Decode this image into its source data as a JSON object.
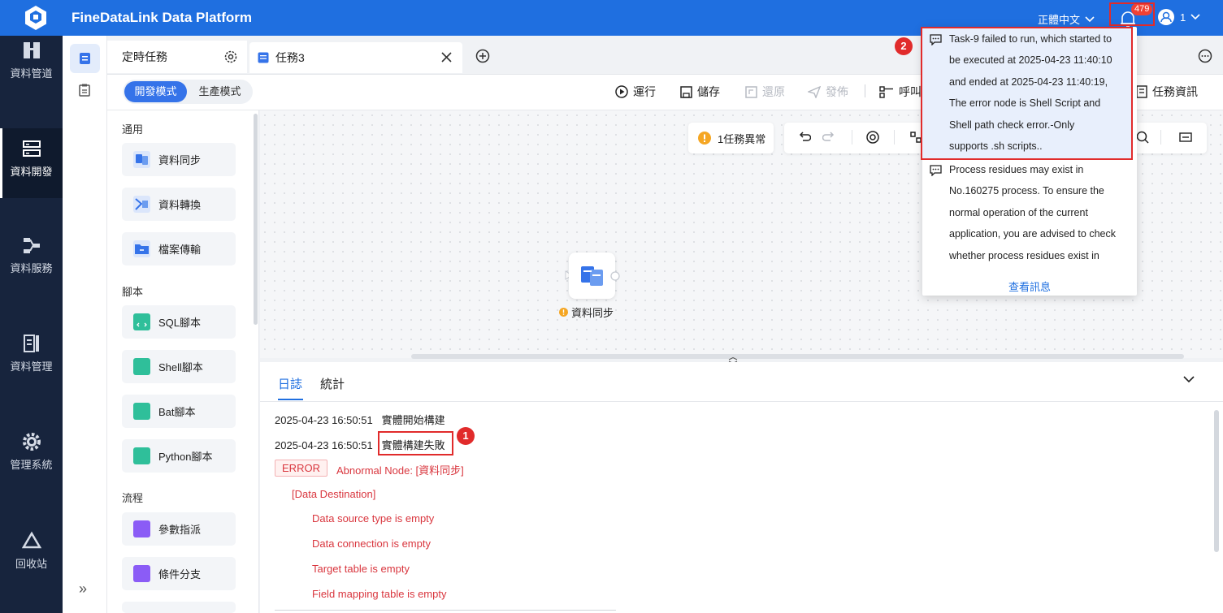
{
  "app": {
    "title": "FineDataLink Data Platform",
    "language": "正體中文",
    "notification_count": "479",
    "user": "1"
  },
  "nav": {
    "items": [
      {
        "label": "資料管道",
        "icon": "pipeline-icon"
      },
      {
        "label": "資料開發",
        "icon": "data-dev-icon",
        "active": true
      },
      {
        "label": "資料服務",
        "icon": "data-service-icon"
      },
      {
        "label": "資料管理",
        "icon": "data-management-icon"
      },
      {
        "label": "管理系統",
        "icon": "gear-icon"
      },
      {
        "label": "回收站",
        "icon": "recycle-icon"
      }
    ],
    "expand": "»"
  },
  "tabs": {
    "scheduled": "定時任務",
    "task": "任務3"
  },
  "mode": {
    "dev": "開發模式",
    "prod": "生產模式"
  },
  "toolbar": {
    "run": "運行",
    "save": "儲存",
    "restore": "還原",
    "publish": "發佈",
    "call": "呼叫",
    "task_info": "任務資訊"
  },
  "panel": {
    "sections": {
      "general": "通用",
      "script": "腳本",
      "flow": "流程"
    },
    "general": [
      "資料同步",
      "資料轉換",
      "檔案傳輸"
    ],
    "script": [
      "SQL腳本",
      "Shell腳本",
      "Bat腳本",
      "Python腳本"
    ],
    "flow": [
      "參數指派",
      "條件分支"
    ]
  },
  "canvas": {
    "alert": "1任務異常",
    "node_label": "資料同步"
  },
  "log": {
    "tabs": {
      "log": "日誌",
      "stats": "統計"
    },
    "lines": [
      {
        "time": "2025-04-23 16:50:51",
        "msg": "實體開始構建"
      },
      {
        "time": "2025-04-23 16:50:51",
        "msg": "實體構建失敗"
      }
    ],
    "error_tag": "ERROR",
    "abnormal_node": "Abnormal Node: [資料同步]",
    "destination": "[Data Destination]",
    "details": [
      "Data source type is empty",
      "Data connection is empty",
      "Target table is empty",
      "Field mapping table is empty"
    ]
  },
  "notifications": {
    "items": [
      [
        "Task-9 failed to run, which started to",
        "be executed at 2025-04-23 11:40:10",
        "and ended at 2025-04-23 11:40:19,",
        "The error node is Shell Script and",
        "Shell path check error.-Only",
        "supports .sh scripts.."
      ],
      [
        "Process residues may exist in",
        "No.160275 process. To ensure the",
        "normal operation of the current",
        "application, you are advised to check",
        "whether process residues exist in"
      ]
    ],
    "more": "查看訊息"
  },
  "callouts": {
    "one": "1",
    "two": "2"
  },
  "colors": {
    "primary": "#1f6fe0",
    "nav_bg": "#17243d",
    "error": "#d9363e",
    "highlight": "#e12b2b"
  }
}
